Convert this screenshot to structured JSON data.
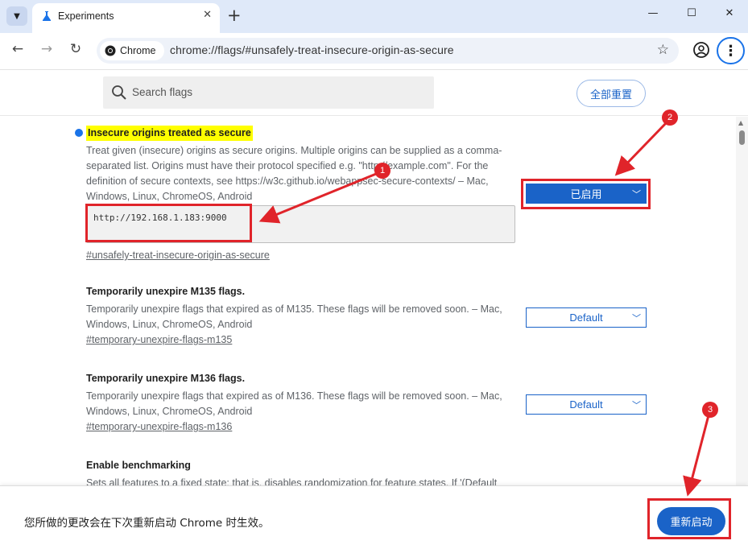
{
  "window": {
    "tab_title": "Experiments",
    "new_tab_symbol": "+",
    "controls": [
      "minimize",
      "maximize",
      "close"
    ]
  },
  "toolbar": {
    "chip_label": "Chrome",
    "url": "chrome://flags/#unsafely-treat-insecure-origin-as-secure"
  },
  "search": {
    "placeholder": "Search flags",
    "reset_all_label": "全部重置"
  },
  "flags": [
    {
      "title": "Insecure origins treated as secure",
      "description": "Treat given (insecure) origins as secure origins. Multiple origins can be supplied as a comma-separated list. Origins must have their protocol specified e.g. \"http://example.com\". For the definition of secure contexts, see https://w3c.github.io/webappsec-secure-contexts/ – Mac, Windows, Linux, ChromeOS, Android",
      "origins_value": "http://192.168.1.183:9000",
      "link": "#unsafely-treat-insecure-origin-as-secure",
      "state": "已启用",
      "highlighted": true
    },
    {
      "title": "Temporarily unexpire M135 flags.",
      "description": "Temporarily unexpire flags that expired as of M135. These flags will be removed soon. – Mac, Windows, Linux, ChromeOS, Android",
      "link": "#temporary-unexpire-flags-m135",
      "state": "Default"
    },
    {
      "title": "Temporarily unexpire M136 flags.",
      "description": "Temporarily unexpire flags that expired as of M136. These flags will be removed soon. – Mac, Windows, Linux, ChromeOS, Android",
      "link": "#temporary-unexpire-flags-m136",
      "state": "Default"
    },
    {
      "title": "Enable benchmarking",
      "description": "Sets all features to a fixed state; that is, disables randomization for feature states. If '(Default"
    }
  ],
  "bottom": {
    "message": "您所做的更改会在下次重新启动 Chrome 时生效。",
    "relaunch_label": "重新启动"
  },
  "annotations": [
    "1",
    "2",
    "3"
  ],
  "colors": {
    "accent": "#1a63c8",
    "annotation_red": "#e0242a",
    "highlight": "#ffff00",
    "titlebar": "#dfe9f9"
  }
}
